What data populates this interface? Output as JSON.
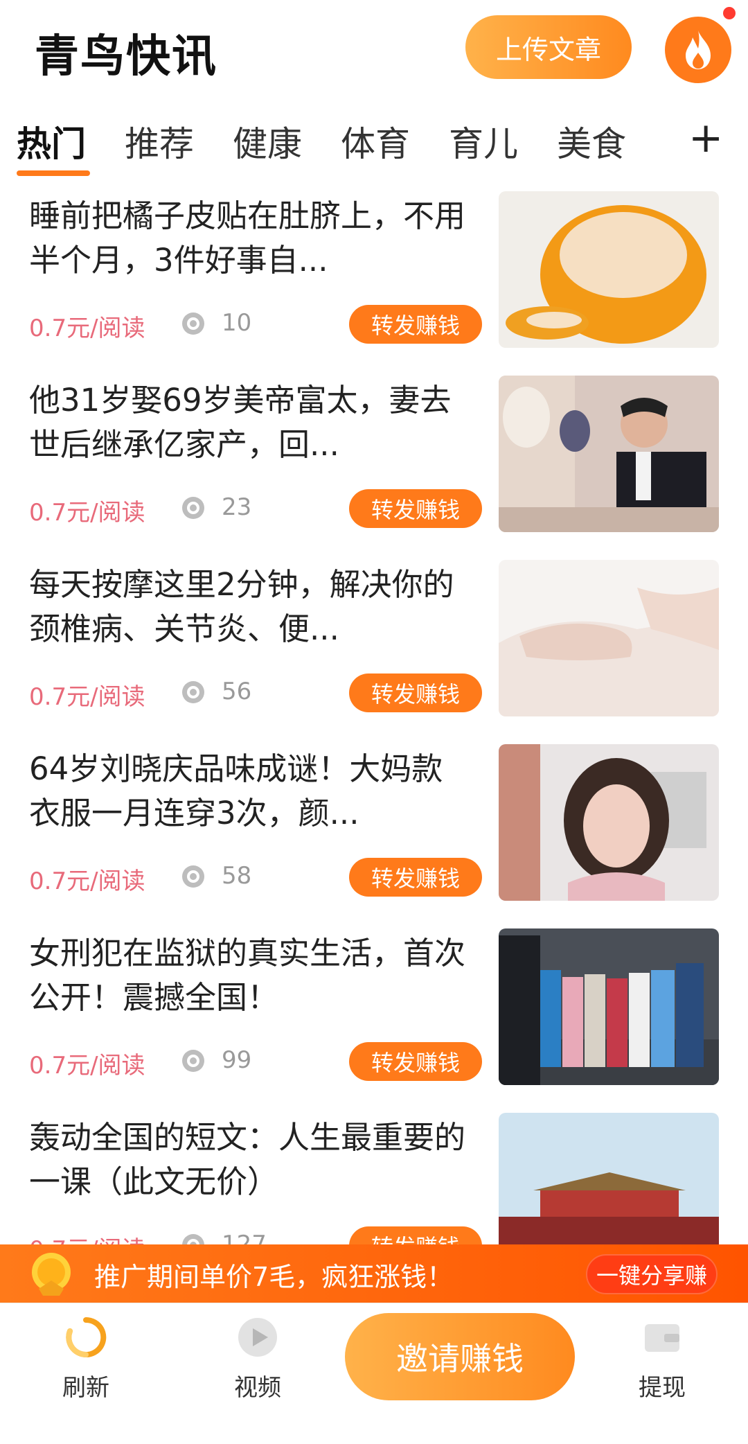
{
  "header": {
    "title": "青鸟快讯",
    "upload_label": "上传文章",
    "fire_icon": "fire-icon"
  },
  "tabs": [
    {
      "label": "热门",
      "active": true
    },
    {
      "label": "推荐"
    },
    {
      "label": "健康"
    },
    {
      "label": "体育"
    },
    {
      "label": "育儿"
    },
    {
      "label": "美食"
    }
  ],
  "tab_add_label": "+",
  "feed": [
    {
      "title": "睡前把橘子皮贴在肚脐上，不用半个月，3件好事自...",
      "price": "0.7元/阅读",
      "views": "10",
      "share_label": "转发赚钱"
    },
    {
      "title": "他31岁娶69岁美帝富太，妻去世后继承亿家产，回...",
      "price": "0.7元/阅读",
      "views": "23",
      "share_label": "转发赚钱"
    },
    {
      "title": "每天按摩这里2分钟，解决你的颈椎病、关节炎、便...",
      "price": "0.7元/阅读",
      "views": "56",
      "share_label": "转发赚钱"
    },
    {
      "title": "64岁刘晓庆品味成谜！大妈款衣服一月连穿3次，颜...",
      "price": "0.7元/阅读",
      "views": "58",
      "share_label": "转发赚钱"
    },
    {
      "title": "女刑犯在监狱的真实生活，首次公开！震撼全国！",
      "price": "0.7元/阅读",
      "views": "99",
      "share_label": "转发赚钱"
    },
    {
      "title": "轰动全国的短文：人生最重要的一课（此文无价）",
      "price": "0.7元/阅读",
      "views": "127",
      "share_label": "转发赚钱"
    }
  ],
  "promo": {
    "text": "推广期间单价7毛，疯狂涨钱！",
    "button_label": "一键分享赚"
  },
  "bottom_nav": {
    "refresh_label": "刷新",
    "video_label": "视频",
    "invite_label": "邀请赚钱",
    "withdraw_label": "提现"
  },
  "colors": {
    "accent": "#ff7a1a",
    "price": "#e86a7a",
    "promo": "#ff5400"
  }
}
